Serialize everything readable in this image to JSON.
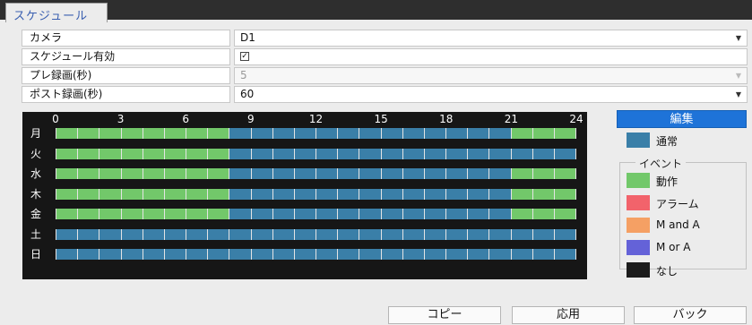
{
  "tab": {
    "title": "スケジュール"
  },
  "settings": [
    {
      "label": "カメラ",
      "value": "D1",
      "kind": "select",
      "disabled": false
    },
    {
      "label": "スケジュール有効",
      "value": "",
      "kind": "checkbox",
      "checked": true
    },
    {
      "label": "プレ録画(秒)",
      "value": "5",
      "kind": "select",
      "disabled": true
    },
    {
      "label": "ポスト録画(秒)",
      "value": "60",
      "kind": "select",
      "disabled": false
    }
  ],
  "checkbox_mark": "✓",
  "dropdown_caret": "▼",
  "schedule": {
    "hour_labels": [
      "0",
      "3",
      "6",
      "9",
      "12",
      "15",
      "18",
      "21",
      "24"
    ],
    "days": [
      {
        "label": "月",
        "green_until": 8,
        "green_from": 21
      },
      {
        "label": "火",
        "green_until": 8,
        "green_from": 24
      },
      {
        "label": "水",
        "green_until": 8,
        "green_from": 21
      },
      {
        "label": "木",
        "green_until": 8,
        "green_from": 21
      },
      {
        "label": "金",
        "green_until": 8,
        "green_from": 21
      },
      {
        "label": "土",
        "green_until": 0,
        "green_from": 24
      },
      {
        "label": "日",
        "green_until": 0,
        "green_from": 24
      }
    ]
  },
  "edit_button": "編集",
  "legend": {
    "normal": {
      "label": "通常",
      "color": "#3a7fa8"
    },
    "event_title": "イベント",
    "events": [
      {
        "label": "動作",
        "color": "#72c86a"
      },
      {
        "label": "アラーム",
        "color": "#f2636b"
      },
      {
        "label": "M and A",
        "color": "#f5a064"
      },
      {
        "label": "M or A",
        "color": "#6462d8"
      }
    ],
    "none": {
      "label": "なし",
      "color": "#1c1c1c"
    }
  },
  "buttons": {
    "copy": "コピー",
    "apply": "応用",
    "back": "バック"
  },
  "colors": {
    "normal": "#3a7fa8",
    "motion": "#72c86a",
    "grid_bg": "#161616",
    "accent": "#1e73d8"
  }
}
